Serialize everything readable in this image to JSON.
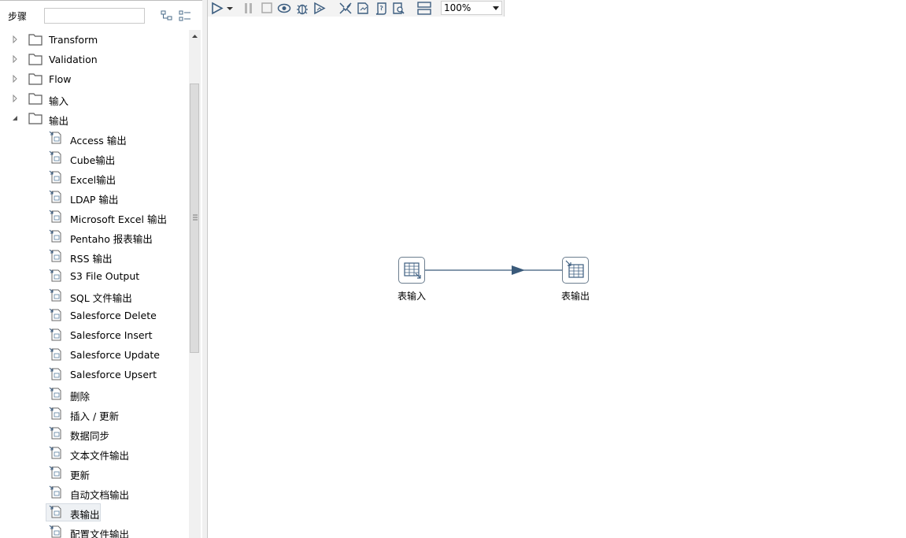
{
  "steps_panel": {
    "title": "步骤",
    "search_placeholder": "",
    "tool_icons": [
      "expand-tree-icon",
      "collapse-tree-icon"
    ]
  },
  "tree": {
    "categories": [
      {
        "label": "Transform",
        "expanded": false
      },
      {
        "label": "Validation",
        "expanded": false
      },
      {
        "label": "Flow",
        "expanded": false
      },
      {
        "label": "输入",
        "expanded": false
      },
      {
        "label": "输出",
        "expanded": true
      }
    ],
    "items": [
      {
        "label": "Access 输出",
        "icon": "access-icon"
      },
      {
        "label": "Cube输出",
        "icon": "cube-icon"
      },
      {
        "label": "Excel输出",
        "icon": "excel-icon"
      },
      {
        "label": "LDAP 输出",
        "icon": "ldap-icon"
      },
      {
        "label": "Microsoft Excel 输出",
        "icon": "excel-icon"
      },
      {
        "label": "Pentaho 报表输出",
        "icon": "report-icon"
      },
      {
        "label": "RSS 输出",
        "icon": "rss-icon"
      },
      {
        "label": "S3 File Output",
        "icon": "s3-icon"
      },
      {
        "label": "SQL 文件输出",
        "icon": "sql-file-icon"
      },
      {
        "label": "Salesforce Delete",
        "icon": "salesforce-delete-icon"
      },
      {
        "label": "Salesforce Insert",
        "icon": "salesforce-insert-icon"
      },
      {
        "label": "Salesforce Update",
        "icon": "salesforce-update-icon"
      },
      {
        "label": "Salesforce Upsert",
        "icon": "salesforce-upsert-icon"
      },
      {
        "label": "删除",
        "icon": "delete-db-icon"
      },
      {
        "label": "插入 / 更新",
        "icon": "insert-update-icon"
      },
      {
        "label": "数据同步",
        "icon": "sync-icon"
      },
      {
        "label": "文本文件输出",
        "icon": "text-file-icon"
      },
      {
        "label": "更新",
        "icon": "refresh-icon"
      },
      {
        "label": "自动文档输出",
        "icon": "auto-doc-icon"
      },
      {
        "label": "表输出",
        "icon": "table-output-icon",
        "selected": true
      },
      {
        "label": "配置文件输出",
        "icon": "config-file-icon"
      }
    ]
  },
  "toolbar": {
    "icons": [
      "run-icon",
      "run-dropdown-icon",
      "pause-icon",
      "stop-icon",
      "preview-icon",
      "debug-icon",
      "replay-icon",
      "verify-icon",
      "analyze-icon",
      "sql-icon",
      "explore-db-icon",
      "align-icon"
    ],
    "zoom": "100%"
  },
  "canvas": {
    "steps": [
      {
        "label": "表输入",
        "icon": "table-input-icon"
      },
      {
        "label": "表输出",
        "icon": "table-output-icon"
      }
    ],
    "hops": [
      {
        "from": "表输入",
        "to": "表输出"
      }
    ]
  },
  "colors": {
    "hop": "#3a5a7a",
    "step_border": "#6c7e8f",
    "folder": "#5a5a5a"
  }
}
